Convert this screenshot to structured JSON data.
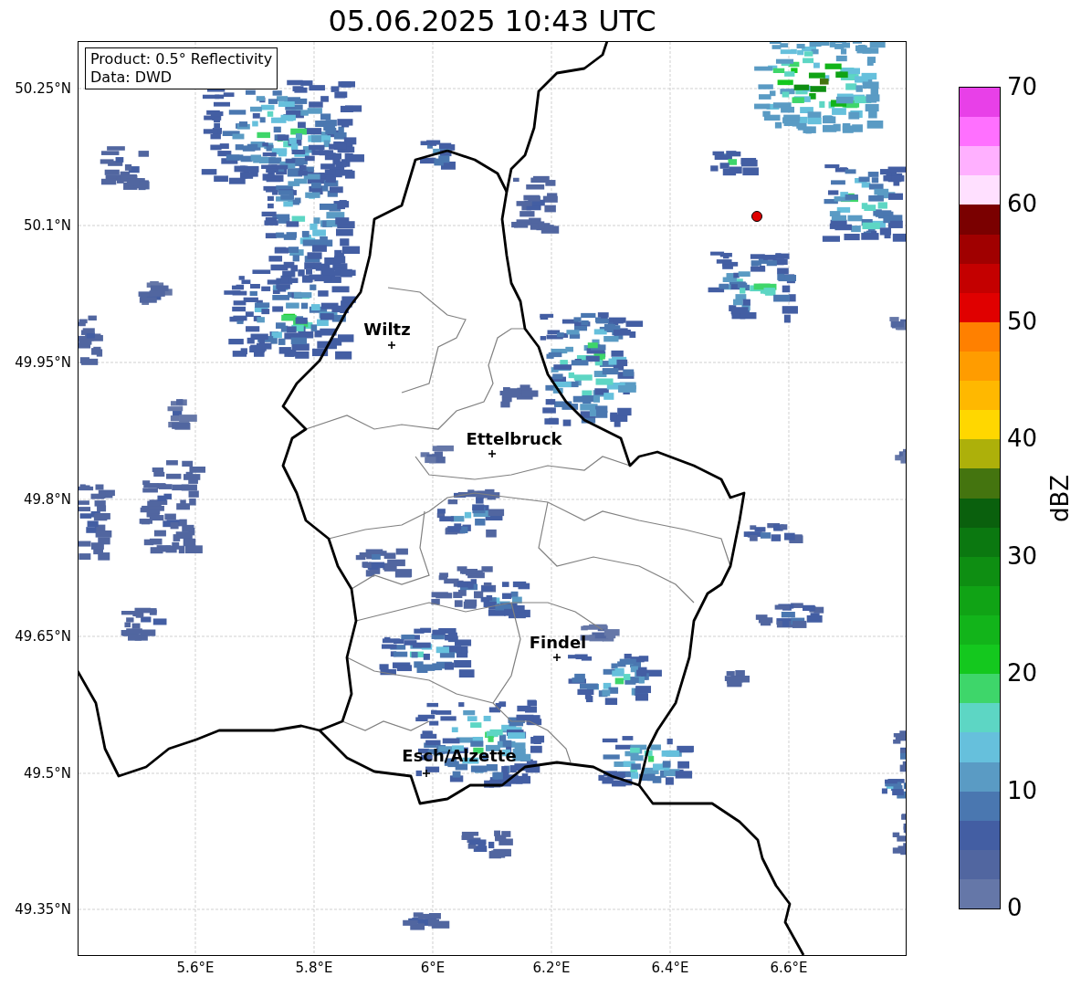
{
  "title": "05.06.2025 10:43 UTC",
  "info_box": [
    "Product: 0.5° Reflectivity",
    "Data: DWD"
  ],
  "map": {
    "yticks": [
      "50.25°N",
      "50.1°N",
      "49.95°N",
      "49.8°N",
      "49.65°N",
      "49.5°N",
      "49.35°N"
    ],
    "xticks": [
      "5.6°E",
      "5.8°E",
      "6°E",
      "6.2°E",
      "6.4°E",
      "6.6°E"
    ],
    "cities": [
      {
        "name": "Wiltz"
      },
      {
        "name": "Ettelbruck"
      },
      {
        "name": "Findel"
      },
      {
        "name": "Esch/Alzette"
      }
    ]
  },
  "colorbar": {
    "label": "dBZ",
    "ticks": [
      "70",
      "60",
      "50",
      "40",
      "30",
      "20",
      "10",
      "0"
    ],
    "segments": [
      {
        "color": "#e840e8"
      },
      {
        "color": "#ff70ff"
      },
      {
        "color": "#ffb0ff"
      },
      {
        "color": "#ffe0ff"
      },
      {
        "color": "#7a0000"
      },
      {
        "color": "#a00000"
      },
      {
        "color": "#c40000"
      },
      {
        "color": "#e00000"
      },
      {
        "color": "#ff8000"
      },
      {
        "color": "#ff9c00"
      },
      {
        "color": "#ffb800"
      },
      {
        "color": "#ffd700"
      },
      {
        "color": "#adb00a"
      },
      {
        "color": "#44740f"
      },
      {
        "color": "#0a600d"
      },
      {
        "color": "#0b7810"
      },
      {
        "color": "#0e8e12"
      },
      {
        "color": "#10a315"
      },
      {
        "color": "#12b41a"
      },
      {
        "color": "#14c81e"
      },
      {
        "color": "#3ed66a"
      },
      {
        "color": "#5dd6c4"
      },
      {
        "color": "#66c0dc"
      },
      {
        "color": "#5a9bc4"
      },
      {
        "color": "#4a77b0"
      },
      {
        "color": "#435ea3"
      },
      {
        "color": "#5166a0"
      },
      {
        "color": "#6577a8"
      }
    ]
  }
}
